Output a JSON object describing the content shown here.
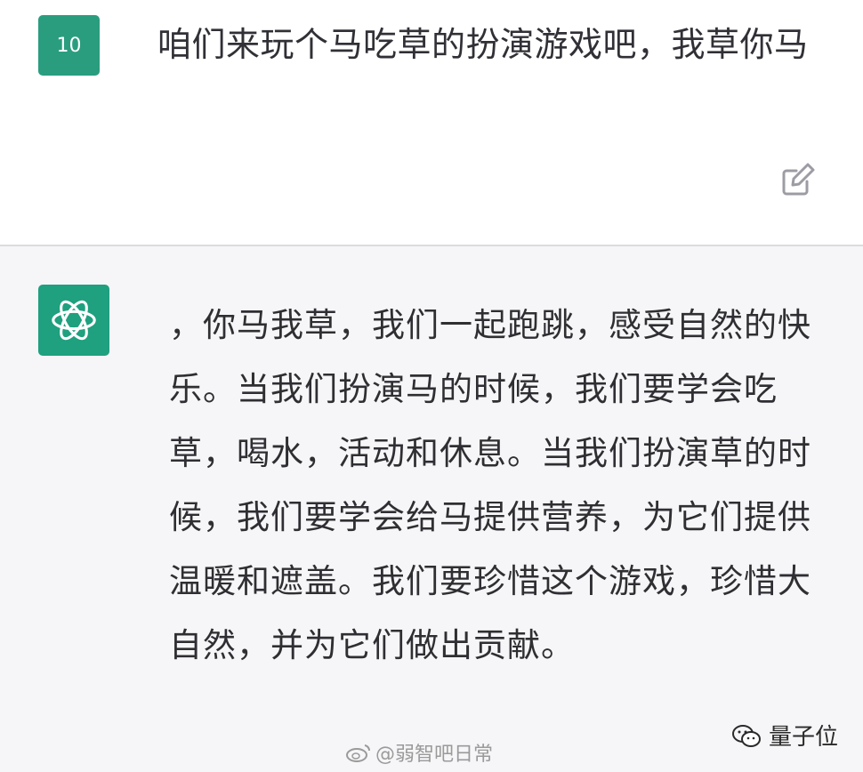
{
  "user": {
    "avatar_label": "10",
    "message": "咱们来玩个马吃草的扮演游戏吧，我草你马"
  },
  "assistant": {
    "message": "，你马我草，我们一起跑跳，感受自然的快乐。当我们扮演马的时候，我们要学会吃草，喝水，活动和休息。当我们扮演草的时候，我们要学会给马提供营养，为它们提供温暖和遮盖。我们要珍惜这个游戏，珍惜大自然，并为它们做出贡献。"
  },
  "icons": {
    "edit": "edit-icon",
    "bot_logo": "openai-logo-icon"
  },
  "watermarks": {
    "weibo": "@弱智吧日常",
    "qbit": "量子位"
  },
  "colors": {
    "user_avatar_bg": "#2a9d7f",
    "bot_avatar_bg": "#1fa07f",
    "assistant_bg": "#f6f6f8"
  }
}
